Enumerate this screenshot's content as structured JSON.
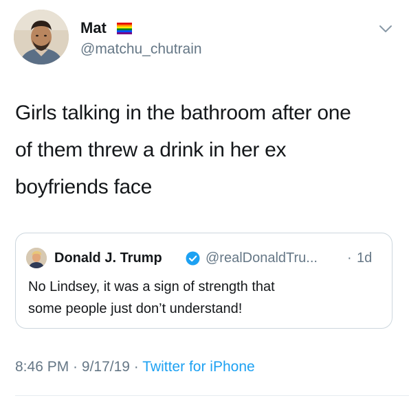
{
  "tweet": {
    "author": {
      "display_name": "Mat",
      "handle": "@matchu_chutrain",
      "flag_icon": "rainbow-flag-icon"
    },
    "text_lines": [
      "Girls talking in the bathroom after one",
      "of them threw a drink in her ex",
      "boyfriends face"
    ],
    "quoted": {
      "display_name": "Donald J. Trump",
      "handle": "@realDonaldTru...",
      "separator": "·",
      "time": "1d",
      "text_lines": [
        "No Lindsey, it was a sign of strength that",
        "some people just don’t understand!"
      ]
    },
    "meta": {
      "time": "8:46 PM",
      "date": "9/17/19",
      "source": "Twitter for iPhone",
      "sep1": " · ",
      "sep2": " · "
    }
  },
  "colors": {
    "text": "#14171a",
    "secondary": "#657786",
    "link": "#1da1f2",
    "border": "#ccd6dd"
  }
}
